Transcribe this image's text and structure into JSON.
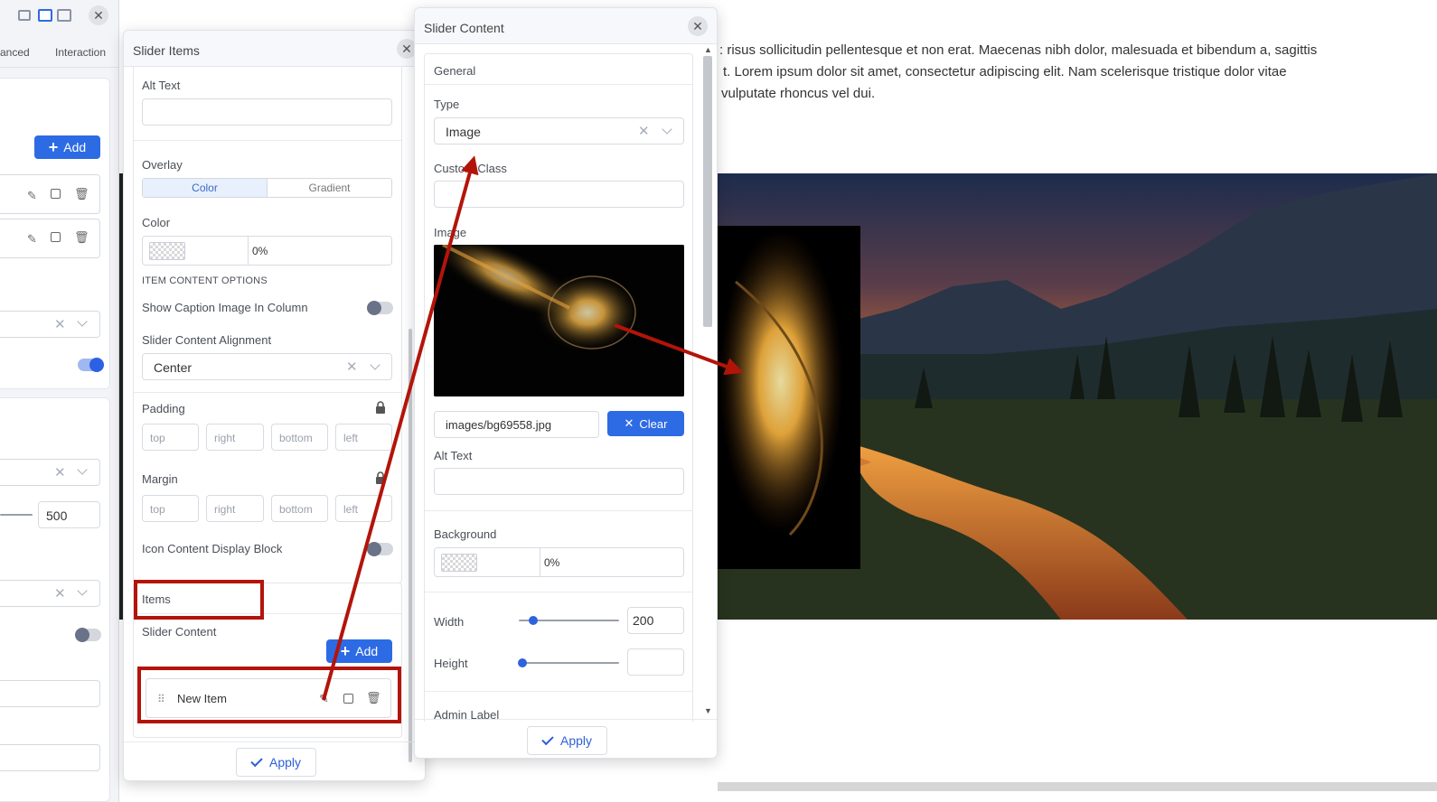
{
  "background": {
    "lines": [
      ": risus sollicitudin pellentesque et non erat. Maecenas nibh dolor, malesuada et bibendum a, sagittis",
      "t. Lorem ipsum dolor sit amet, consectetur adipiscing elit. Nam scelerisque tristique dolor vitae",
      "vulputate rhoncus vel dui."
    ]
  },
  "left_panel": {
    "tab_advanced": "anced",
    "tab_interaction": "Interaction",
    "add_label": "Add",
    "number_value": "500"
  },
  "slider_items": {
    "title": "Slider Items",
    "alt_text_label": "Alt Text",
    "overlay_label": "Overlay",
    "overlay_tabs": [
      "Color",
      "Gradient"
    ],
    "color_label": "Color",
    "color_opacity": "0%",
    "item_content_options": "ITEM CONTENT OPTIONS",
    "show_caption_label": "Show Caption Image In Column",
    "alignment_label": "Slider Content Alignment",
    "alignment_value": "Center",
    "padding_label": "Padding",
    "margin_label": "Margin",
    "side_placeholders": [
      "top",
      "right",
      "bottom",
      "left"
    ],
    "icon_block_label": "Icon Content Display Block",
    "items_label": "Items",
    "slider_content_label": "Slider Content",
    "add_label": "Add",
    "new_item_label": "New Item",
    "apply_label": "Apply"
  },
  "slider_content": {
    "title": "Slider Content",
    "general_label": "General",
    "type_label": "Type",
    "type_value": "Image",
    "custom_class_label": "Custom Class",
    "image_label": "Image",
    "image_path": "images/bg69558.jpg",
    "clear_label": "Clear",
    "alt_text_label": "Alt Text",
    "background_label": "Background",
    "background_opacity": "0%",
    "width_label": "Width",
    "width_value": "200",
    "height_label": "Height",
    "admin_label": "Admin Label",
    "apply_label": "Apply"
  },
  "colors": {
    "accent": "#2d6be4",
    "annotation_red": "#b3140a"
  }
}
